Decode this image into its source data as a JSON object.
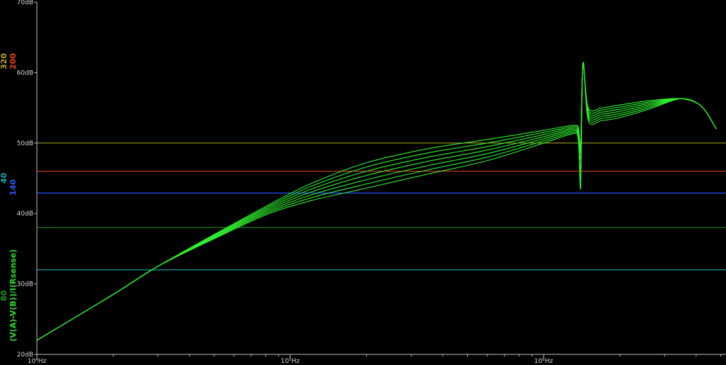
{
  "chart_data": {
    "type": "line",
    "xscale": "log",
    "xlim": [
      10000,
      2000000
    ],
    "ylim": [
      20,
      70
    ],
    "y_unit": "dB",
    "grid": false,
    "background": "#000000",
    "x_ticks": [
      {
        "value": 10000,
        "label": "10⁴Hz"
      },
      {
        "value": 100000,
        "label": "10⁵Hz"
      },
      {
        "value": 1000000,
        "label": "10⁶Hz"
      }
    ],
    "y_ticks": [
      {
        "value": 20,
        "label": "20dB"
      },
      {
        "value": 30,
        "label": "30dB"
      },
      {
        "value": 40,
        "label": "40dB"
      },
      {
        "value": 50,
        "label": "50dB"
      },
      {
        "value": 60,
        "label": "60dB"
      },
      {
        "value": 70,
        "label": "70dB"
      }
    ],
    "legend": [
      {
        "text": "(V(A)-V(B))/I(Rsense)",
        "color": "#28e028"
      },
      {
        "text": "80",
        "color": "#1f9a1f"
      },
      {
        "text": "40",
        "color": "#1aa6a6"
      },
      {
        "text": "140",
        "color": "#2a55ff"
      },
      {
        "text": "200",
        "color": "#e8401c"
      },
      {
        "text": "320",
        "color": "#b3a22a"
      }
    ],
    "series": [
      {
        "name": "320",
        "color": "#9a9a24",
        "x": [
          10000,
          2000000
        ],
        "y": [
          50,
          50
        ]
      },
      {
        "name": "200",
        "color": "#d03a1a",
        "x": [
          10000,
          2000000
        ],
        "y": [
          46,
          46
        ]
      },
      {
        "name": "140",
        "color": "#1f4fff",
        "x": [
          10000,
          2000000
        ],
        "y": [
          42.9,
          42.9
        ]
      },
      {
        "name": "80",
        "color": "#1e8e1e",
        "x": [
          10000,
          2000000
        ],
        "y": [
          38,
          38
        ]
      },
      {
        "name": "40",
        "color": "#159a9a",
        "x": [
          10000,
          2000000
        ],
        "y": [
          32,
          32
        ]
      }
    ],
    "sweep": {
      "color": "#2ef02e",
      "curves": [
        {
          "x": [
            10000,
            20000,
            30000,
            50000,
            80000,
            120000,
            200000,
            350000,
            600000,
            1000000,
            1300000,
            1370000,
            1400000,
            1430000,
            1500000,
            1700000,
            2000000,
            2600000,
            3500000,
            4200000,
            4800000
          ],
          "y": [
            22,
            28.5,
            32.5,
            37,
            41,
            44.2,
            47.2,
            49.2,
            50.5,
            51.8,
            52.5,
            52.2,
            50,
            61.3,
            55,
            55,
            55.4,
            56,
            56.3,
            55.2,
            52
          ]
        },
        {
          "x": [
            10000,
            20000,
            30000,
            50000,
            80000,
            120000,
            200000,
            350000,
            600000,
            1000000,
            1300000,
            1370000,
            1400000,
            1430000,
            1500000,
            1700000,
            2000000,
            2600000,
            3500000,
            4200000,
            4800000
          ],
          "y": [
            22,
            28.5,
            32.5,
            36.9,
            40.8,
            43.8,
            46.6,
            48.6,
            50.0,
            51.5,
            52.3,
            52.0,
            49.5,
            61.3,
            54.7,
            54.7,
            55.1,
            55.8,
            56.3,
            55.2,
            52
          ]
        },
        {
          "x": [
            10000,
            20000,
            30000,
            50000,
            80000,
            120000,
            200000,
            350000,
            600000,
            1000000,
            1300000,
            1370000,
            1400000,
            1430000,
            1500000,
            1700000,
            2000000,
            2600000,
            3500000,
            4200000,
            4800000
          ],
          "y": [
            22,
            28.5,
            32.5,
            36.8,
            40.6,
            43.4,
            46.0,
            48.0,
            49.5,
            51.2,
            52.1,
            51.7,
            49.0,
            61.3,
            54.4,
            54.4,
            54.8,
            55.6,
            56.3,
            55.2,
            52
          ]
        },
        {
          "x": [
            10000,
            20000,
            30000,
            50000,
            80000,
            120000,
            200000,
            350000,
            600000,
            1000000,
            1300000,
            1370000,
            1400000,
            1430000,
            1500000,
            1700000,
            2000000,
            2600000,
            3500000,
            4200000,
            4800000
          ],
          "y": [
            22,
            28.5,
            32.5,
            36.7,
            40.4,
            43.0,
            45.4,
            47.4,
            49.0,
            50.9,
            51.9,
            51.4,
            48.0,
            61.3,
            54.1,
            54.1,
            54.5,
            55.4,
            56.3,
            55.2,
            52
          ]
        },
        {
          "x": [
            10000,
            20000,
            30000,
            50000,
            80000,
            120000,
            200000,
            350000,
            600000,
            1000000,
            1300000,
            1370000,
            1400000,
            1430000,
            1500000,
            1700000,
            2000000,
            2600000,
            3500000,
            4200000,
            4800000
          ],
          "y": [
            22,
            28.5,
            32.5,
            36.6,
            40.2,
            42.6,
            44.8,
            46.8,
            48.5,
            50.6,
            51.7,
            51.1,
            46.5,
            61.3,
            53.8,
            53.8,
            54.2,
            55.2,
            56.3,
            55.2,
            52
          ]
        },
        {
          "x": [
            10000,
            20000,
            30000,
            50000,
            80000,
            120000,
            200000,
            350000,
            600000,
            1000000,
            1300000,
            1370000,
            1400000,
            1430000,
            1500000,
            1700000,
            2000000,
            2600000,
            3500000,
            4200000,
            4800000
          ],
          "y": [
            22,
            28.5,
            32.5,
            36.5,
            40.0,
            42.2,
            44.2,
            46.2,
            48.0,
            50.3,
            51.5,
            50.8,
            45.0,
            61.3,
            53.5,
            53.5,
            53.9,
            55.0,
            56.3,
            55.2,
            52
          ]
        },
        {
          "x": [
            10000,
            20000,
            30000,
            50000,
            80000,
            120000,
            200000,
            350000,
            600000,
            1000000,
            1300000,
            1370000,
            1400000,
            1430000,
            1500000,
            1700000,
            2000000,
            2600000,
            3500000,
            4200000,
            4800000
          ],
          "y": [
            22,
            28.5,
            32.5,
            36.4,
            39.8,
            41.8,
            43.6,
            45.6,
            47.5,
            50.0,
            51.3,
            50.5,
            43.7,
            61.3,
            53.2,
            53.2,
            53.6,
            54.8,
            56.3,
            55.2,
            52
          ]
        }
      ]
    }
  }
}
